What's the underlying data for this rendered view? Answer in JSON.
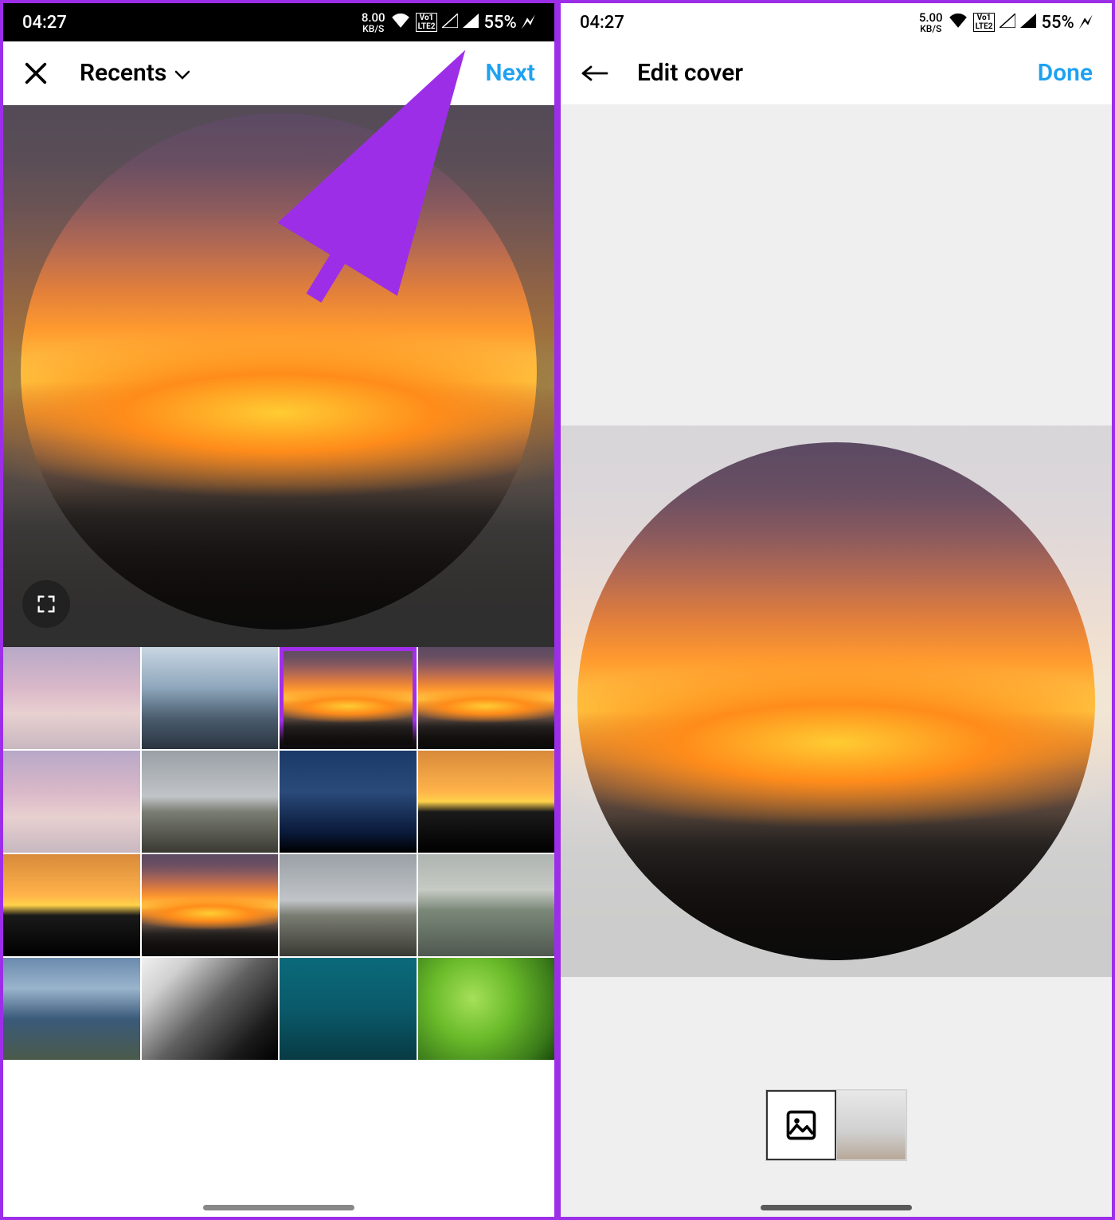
{
  "left": {
    "status": {
      "time": "04:27",
      "kbs": "8.00",
      "kbs_unit": "KB/S",
      "lte": "Vo1\nLTE2",
      "battery": "55%"
    },
    "bar": {
      "album": "Recents",
      "action": "Next"
    },
    "thumbs": [
      "pastel",
      "lake",
      "sunset",
      "sunset",
      "pastel",
      "grey-sky",
      "blue-hour",
      "silhouette",
      "silhouette",
      "sunset",
      "grey-sky",
      "street",
      "ocean",
      "bw",
      "teal-door",
      "green"
    ],
    "selected_index": 2
  },
  "right": {
    "status": {
      "time": "04:27",
      "kbs": "5.00",
      "kbs_unit": "KB/S",
      "lte": "Vo1\nLTE2",
      "battery": "55%"
    },
    "bar": {
      "title": "Edit cover",
      "action": "Done"
    }
  }
}
